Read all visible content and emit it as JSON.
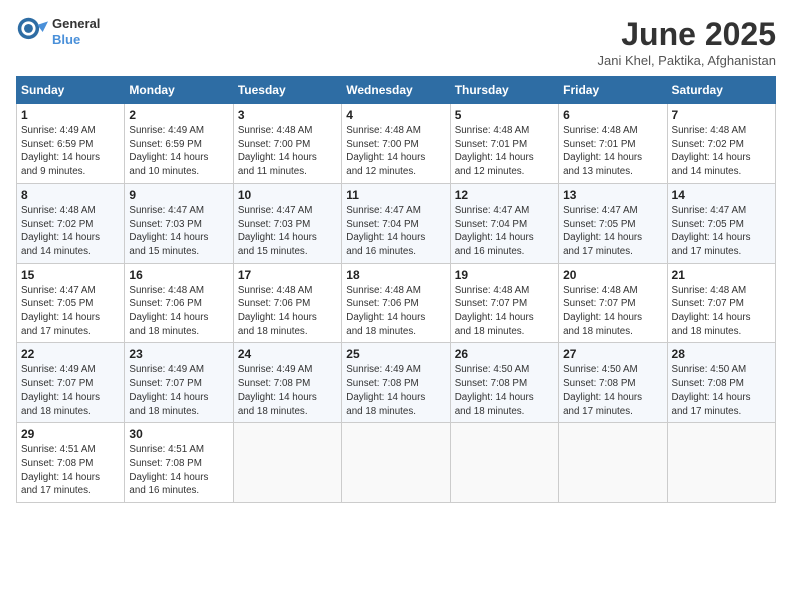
{
  "header": {
    "logo_line1": "General",
    "logo_line2": "Blue",
    "month_year": "June 2025",
    "location": "Jani Khel, Paktika, Afghanistan"
  },
  "days_of_week": [
    "Sunday",
    "Monday",
    "Tuesday",
    "Wednesday",
    "Thursday",
    "Friday",
    "Saturday"
  ],
  "weeks": [
    [
      {
        "day": "1",
        "info": "Sunrise: 4:49 AM\nSunset: 6:59 PM\nDaylight: 14 hours\nand 9 minutes."
      },
      {
        "day": "2",
        "info": "Sunrise: 4:49 AM\nSunset: 6:59 PM\nDaylight: 14 hours\nand 10 minutes."
      },
      {
        "day": "3",
        "info": "Sunrise: 4:48 AM\nSunset: 7:00 PM\nDaylight: 14 hours\nand 11 minutes."
      },
      {
        "day": "4",
        "info": "Sunrise: 4:48 AM\nSunset: 7:00 PM\nDaylight: 14 hours\nand 12 minutes."
      },
      {
        "day": "5",
        "info": "Sunrise: 4:48 AM\nSunset: 7:01 PM\nDaylight: 14 hours\nand 12 minutes."
      },
      {
        "day": "6",
        "info": "Sunrise: 4:48 AM\nSunset: 7:01 PM\nDaylight: 14 hours\nand 13 minutes."
      },
      {
        "day": "7",
        "info": "Sunrise: 4:48 AM\nSunset: 7:02 PM\nDaylight: 14 hours\nand 14 minutes."
      }
    ],
    [
      {
        "day": "8",
        "info": "Sunrise: 4:48 AM\nSunset: 7:02 PM\nDaylight: 14 hours\nand 14 minutes."
      },
      {
        "day": "9",
        "info": "Sunrise: 4:47 AM\nSunset: 7:03 PM\nDaylight: 14 hours\nand 15 minutes."
      },
      {
        "day": "10",
        "info": "Sunrise: 4:47 AM\nSunset: 7:03 PM\nDaylight: 14 hours\nand 15 minutes."
      },
      {
        "day": "11",
        "info": "Sunrise: 4:47 AM\nSunset: 7:04 PM\nDaylight: 14 hours\nand 16 minutes."
      },
      {
        "day": "12",
        "info": "Sunrise: 4:47 AM\nSunset: 7:04 PM\nDaylight: 14 hours\nand 16 minutes."
      },
      {
        "day": "13",
        "info": "Sunrise: 4:47 AM\nSunset: 7:05 PM\nDaylight: 14 hours\nand 17 minutes."
      },
      {
        "day": "14",
        "info": "Sunrise: 4:47 AM\nSunset: 7:05 PM\nDaylight: 14 hours\nand 17 minutes."
      }
    ],
    [
      {
        "day": "15",
        "info": "Sunrise: 4:47 AM\nSunset: 7:05 PM\nDaylight: 14 hours\nand 17 minutes."
      },
      {
        "day": "16",
        "info": "Sunrise: 4:48 AM\nSunset: 7:06 PM\nDaylight: 14 hours\nand 18 minutes."
      },
      {
        "day": "17",
        "info": "Sunrise: 4:48 AM\nSunset: 7:06 PM\nDaylight: 14 hours\nand 18 minutes."
      },
      {
        "day": "18",
        "info": "Sunrise: 4:48 AM\nSunset: 7:06 PM\nDaylight: 14 hours\nand 18 minutes."
      },
      {
        "day": "19",
        "info": "Sunrise: 4:48 AM\nSunset: 7:07 PM\nDaylight: 14 hours\nand 18 minutes."
      },
      {
        "day": "20",
        "info": "Sunrise: 4:48 AM\nSunset: 7:07 PM\nDaylight: 14 hours\nand 18 minutes."
      },
      {
        "day": "21",
        "info": "Sunrise: 4:48 AM\nSunset: 7:07 PM\nDaylight: 14 hours\nand 18 minutes."
      }
    ],
    [
      {
        "day": "22",
        "info": "Sunrise: 4:49 AM\nSunset: 7:07 PM\nDaylight: 14 hours\nand 18 minutes."
      },
      {
        "day": "23",
        "info": "Sunrise: 4:49 AM\nSunset: 7:07 PM\nDaylight: 14 hours\nand 18 minutes."
      },
      {
        "day": "24",
        "info": "Sunrise: 4:49 AM\nSunset: 7:08 PM\nDaylight: 14 hours\nand 18 minutes."
      },
      {
        "day": "25",
        "info": "Sunrise: 4:49 AM\nSunset: 7:08 PM\nDaylight: 14 hours\nand 18 minutes."
      },
      {
        "day": "26",
        "info": "Sunrise: 4:50 AM\nSunset: 7:08 PM\nDaylight: 14 hours\nand 18 minutes."
      },
      {
        "day": "27",
        "info": "Sunrise: 4:50 AM\nSunset: 7:08 PM\nDaylight: 14 hours\nand 17 minutes."
      },
      {
        "day": "28",
        "info": "Sunrise: 4:50 AM\nSunset: 7:08 PM\nDaylight: 14 hours\nand 17 minutes."
      }
    ],
    [
      {
        "day": "29",
        "info": "Sunrise: 4:51 AM\nSunset: 7:08 PM\nDaylight: 14 hours\nand 17 minutes."
      },
      {
        "day": "30",
        "info": "Sunrise: 4:51 AM\nSunset: 7:08 PM\nDaylight: 14 hours\nand 16 minutes."
      },
      {
        "day": "",
        "info": ""
      },
      {
        "day": "",
        "info": ""
      },
      {
        "day": "",
        "info": ""
      },
      {
        "day": "",
        "info": ""
      },
      {
        "day": "",
        "info": ""
      }
    ]
  ]
}
